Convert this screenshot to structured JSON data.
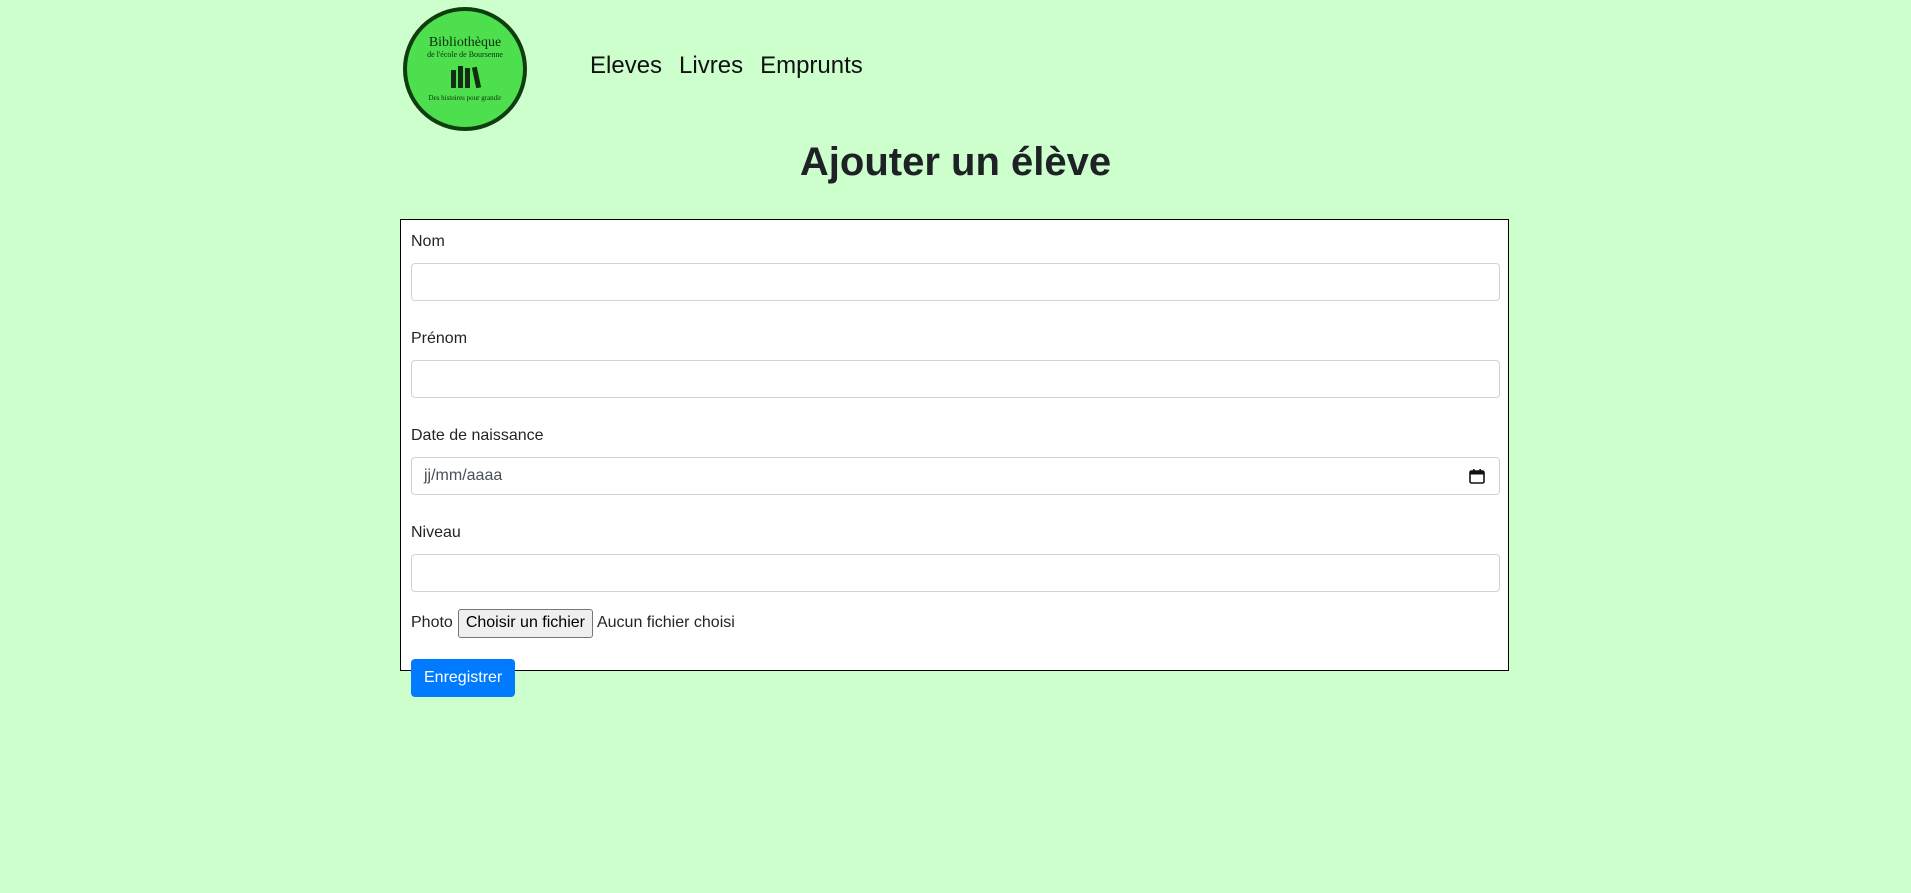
{
  "logo": {
    "title": "Bibliothèque",
    "subtitle": "de l'école de Boursenne",
    "motto": "Des histoires pour grandir"
  },
  "nav": {
    "items": [
      {
        "label": "Eleves"
      },
      {
        "label": "Livres"
      },
      {
        "label": "Emprunts"
      }
    ]
  },
  "page": {
    "title": "Ajouter un élève"
  },
  "form": {
    "nom": {
      "label": "Nom",
      "value": ""
    },
    "prenom": {
      "label": "Prénom",
      "value": ""
    },
    "date_naissance": {
      "label": "Date de naissance",
      "placeholder": "jj/mm/aaaa"
    },
    "niveau": {
      "label": "Niveau",
      "value": ""
    },
    "photo": {
      "label": "Photo",
      "button_label": "Choisir un fichier",
      "status": "Aucun fichier choisi"
    },
    "submit_label": "Enregistrer"
  },
  "colors": {
    "page_background": "#ccffcc",
    "logo_fill": "#4ddf4d",
    "primary_button": "#007bff"
  },
  "icons": {
    "calendar": "calendar-icon"
  }
}
